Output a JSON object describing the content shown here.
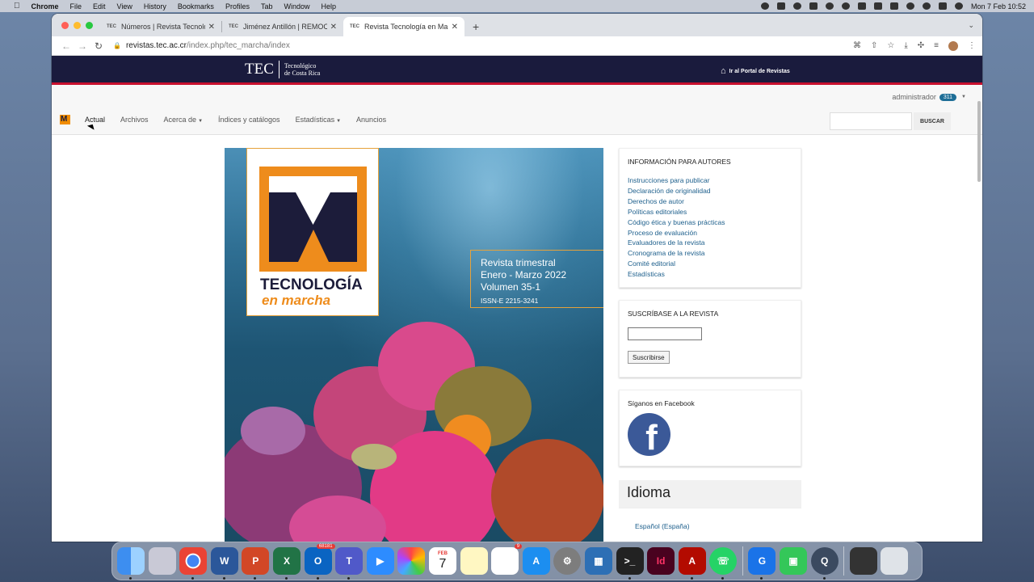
{
  "menubar": {
    "app": "Chrome",
    "items": [
      "File",
      "Edit",
      "View",
      "History",
      "Bookmarks",
      "Profiles",
      "Tab",
      "Window",
      "Help"
    ],
    "clock": "Mon 7 Feb  10:52"
  },
  "browser": {
    "tabs": [
      {
        "favicon": "TEC",
        "title": "Números | Revista Tecnología e"
      },
      {
        "favicon": "TEC",
        "title": "Jiménez Antillón | REMOCIÓN D"
      },
      {
        "favicon": "TEC",
        "title": "Revista Tecnología en Marcha"
      }
    ],
    "url_host": "revistas.tec.ac.cr",
    "url_path": "/index.php/tec_marcha/index"
  },
  "site": {
    "logo_big": "TEC",
    "logo_small_1": "Tecnológico",
    "logo_small_2": "de Costa Rica",
    "portal_link": "Ir al Portal de Revistas",
    "user": "administrador",
    "user_badge": "311",
    "nav": [
      "Actual",
      "Archivos",
      "Acerca de",
      "Índices y catálogos",
      "Estadísticas",
      "Anuncios"
    ],
    "search_button": "BUSCAR"
  },
  "cover": {
    "brand_1": "TECNOLOGÍA",
    "brand_2": "en marcha",
    "line1": "Revista trimestral",
    "line2": "Enero - Marzo 2022",
    "line3": "Volumen 35-1",
    "issn": "ISSN-E 2215-3241"
  },
  "sidebar": {
    "authors_title": "INFORMACIÓN PARA AUTORES",
    "authors_links": [
      "Instrucciones para publicar",
      "Declaración de originalidad",
      "Derechos de autor",
      "Políticas editoriales",
      "Código ética y buenas prácticas",
      "Proceso de evaluación",
      "Evaluadores de la revista",
      "Cronograma de la revista",
      "Comité editorial",
      "Estadísticas"
    ],
    "subscribe_title": "SUSCRÍBASE A LA REVISTA",
    "subscribe_button": "Suscribirse",
    "facebook_title": "Síganos en Facebook",
    "language_title": "Idioma",
    "language_option": "Español (España)"
  },
  "dock": {
    "outlook_badge": "68181",
    "reminders_badge": "9",
    "calendar_month": "FEB",
    "calendar_day": "7"
  }
}
